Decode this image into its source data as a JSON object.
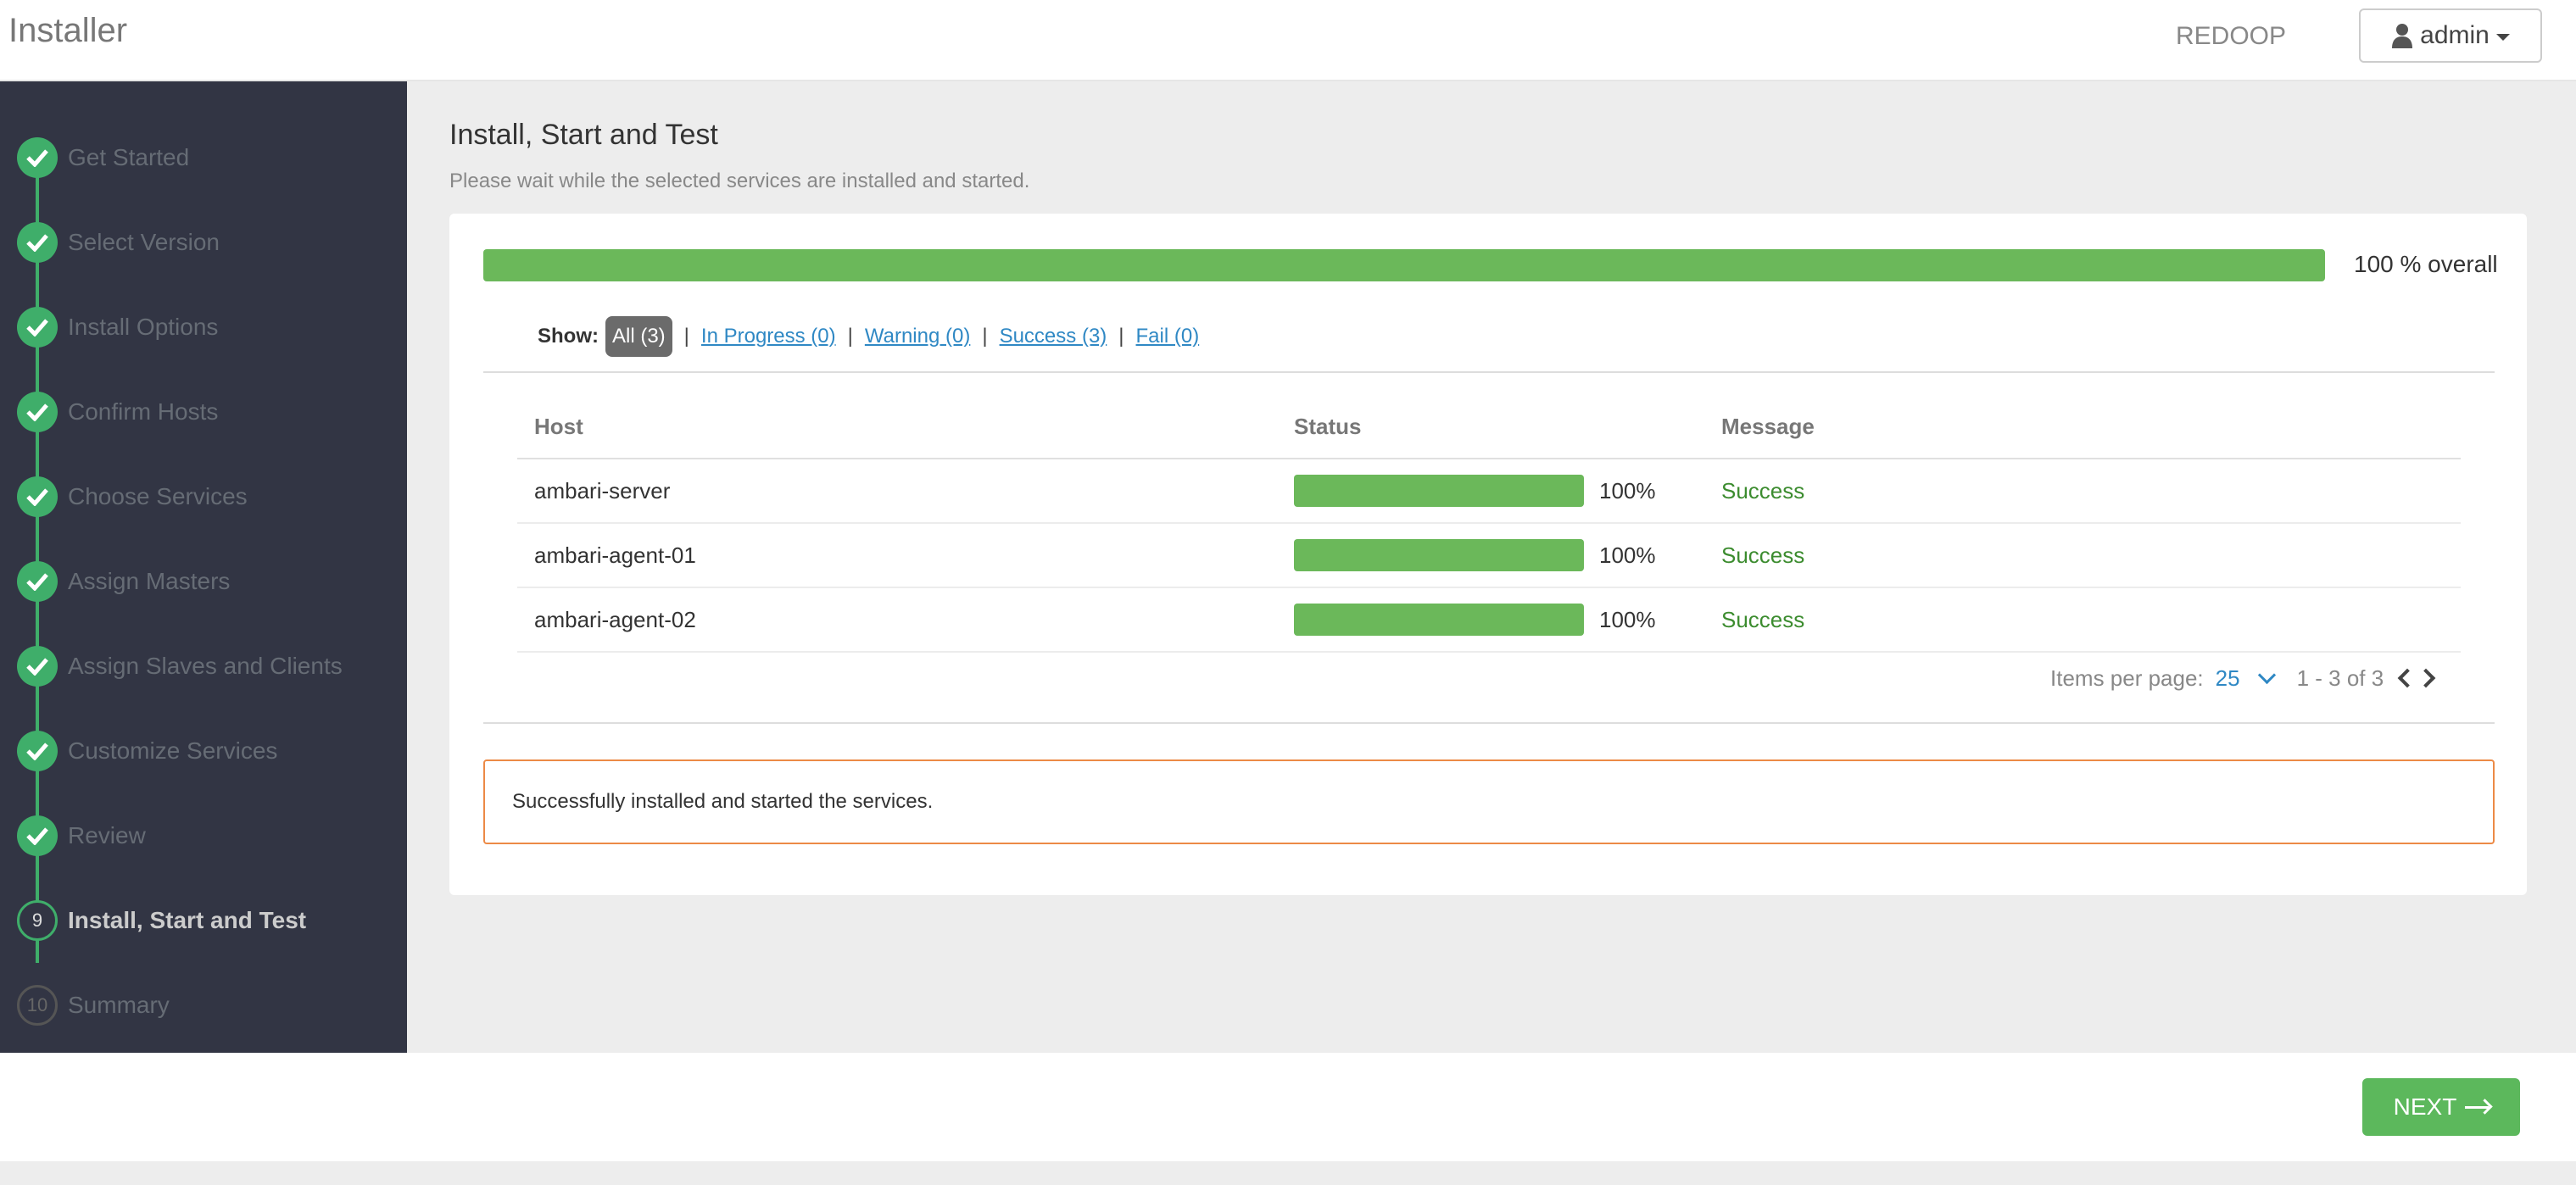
{
  "header": {
    "app_title": "Installer",
    "cluster_name": "REDOOP",
    "user_label": "admin"
  },
  "sidebar": {
    "steps": [
      {
        "label": "Get Started",
        "state": "done"
      },
      {
        "label": "Select Version",
        "state": "done"
      },
      {
        "label": "Install Options",
        "state": "done"
      },
      {
        "label": "Confirm Hosts",
        "state": "done"
      },
      {
        "label": "Choose Services",
        "state": "done"
      },
      {
        "label": "Assign Masters",
        "state": "done"
      },
      {
        "label": "Assign Slaves and Clients",
        "state": "done"
      },
      {
        "label": "Customize Services",
        "state": "done"
      },
      {
        "label": "Review",
        "state": "done"
      },
      {
        "label": "Install, Start and Test",
        "state": "current",
        "number": "9"
      },
      {
        "label": "Summary",
        "state": "todo",
        "number": "10"
      }
    ]
  },
  "main": {
    "title": "Install, Start and Test",
    "subtitle": "Please wait while the selected services are installed and started.",
    "overall_progress": 1.0,
    "overall_label": "100 % overall",
    "filters": {
      "show_label": "Show:",
      "all": "All (3)",
      "in_progress": "In Progress (0)",
      "warning": "Warning (0)",
      "success": "Success (3)",
      "fail": "Fail (0)",
      "separator": "|"
    },
    "table": {
      "headers": [
        "Host",
        "Status",
        "Message"
      ],
      "rows": [
        {
          "host": "ambari-server",
          "progress": 1.0,
          "percent": "100%",
          "message": "Success"
        },
        {
          "host": "ambari-agent-01",
          "progress": 1.0,
          "percent": "100%",
          "message": "Success"
        },
        {
          "host": "ambari-agent-02",
          "progress": 1.0,
          "percent": "100%",
          "message": "Success"
        }
      ]
    },
    "pager": {
      "items_per_page_label": "Items per page:",
      "items_per_page_value": "25",
      "range": "1 - 3 of 3"
    },
    "alert_text": "Successfully installed and started the services."
  },
  "footer": {
    "next_label": "NEXT"
  },
  "colors": {
    "sidebar_bg": "#323544",
    "accent_green": "#3fae6a",
    "progress_green": "#6bb85a",
    "link_blue": "#2f88c4",
    "alert_border": "#ec8a46"
  }
}
